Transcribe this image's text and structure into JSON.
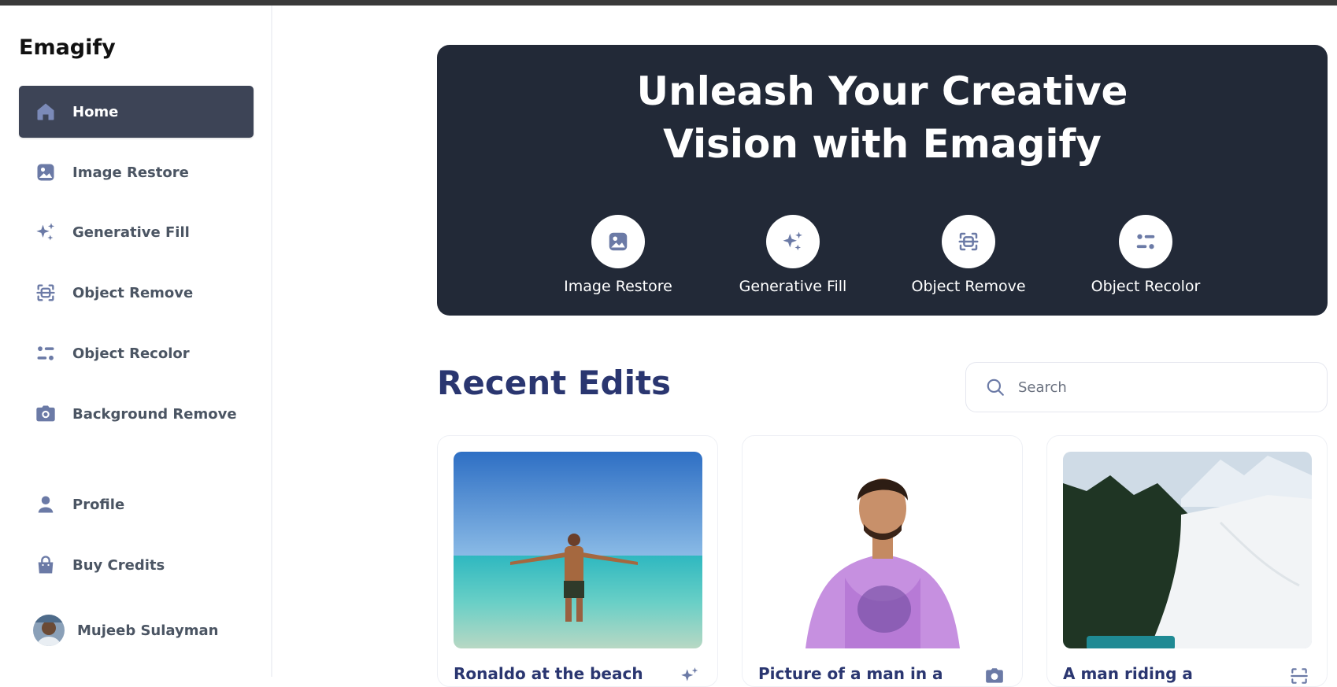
{
  "app": {
    "name": "Emagify"
  },
  "sidebar": {
    "items": [
      {
        "label": "Home",
        "icon": "home-icon",
        "active": true
      },
      {
        "label": "Image Restore",
        "icon": "image-icon"
      },
      {
        "label": "Generative Fill",
        "icon": "sparkles-icon"
      },
      {
        "label": "Object Remove",
        "icon": "scan-icon"
      },
      {
        "label": "Object Recolor",
        "icon": "filter-icon"
      },
      {
        "label": "Background Remove",
        "icon": "camera-icon"
      }
    ],
    "bottom": [
      {
        "label": "Profile",
        "icon": "user-icon"
      },
      {
        "label": "Buy Credits",
        "icon": "bag-icon"
      }
    ],
    "user": {
      "name": "Mujeeb Sulayman"
    }
  },
  "hero": {
    "title_line1": "Unleash Your Creative",
    "title_line2": "Vision with Emagify",
    "tools": [
      {
        "label": "Image Restore",
        "icon": "image-icon"
      },
      {
        "label": "Generative Fill",
        "icon": "sparkles-icon"
      },
      {
        "label": "Object Remove",
        "icon": "scan-icon"
      },
      {
        "label": "Object Recolor",
        "icon": "filter-icon"
      }
    ]
  },
  "recent": {
    "title": "Recent Edits",
    "search_placeholder": "Search",
    "cards": [
      {
        "title": "Ronaldo at the beach",
        "icon": "sparkles-icon"
      },
      {
        "title": "Picture of a man in a",
        "icon": "camera-icon"
      },
      {
        "title": "A man riding a",
        "icon": "scan-icon"
      }
    ]
  },
  "colors": {
    "accent": "#3d4456",
    "hero_bg": "#222937",
    "heading": "#2a3670",
    "icon": "#6b7aa6"
  }
}
